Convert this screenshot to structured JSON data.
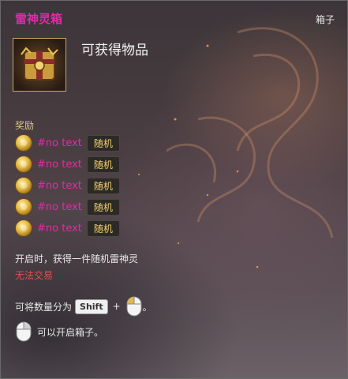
{
  "tooltip": {
    "title": "雷神灵箱",
    "type": "箱子",
    "subtitle": "可获得物品",
    "section_label": "奖励",
    "rewards": [
      {
        "name": "#no text",
        "tag": "随机"
      },
      {
        "name": "#no text",
        "tag": "随机"
      },
      {
        "name": "#no text",
        "tag": "随机"
      },
      {
        "name": "#no text",
        "tag": "随机"
      },
      {
        "name": "#no text",
        "tag": "随机"
      }
    ],
    "description": "开启时，获得一件随机雷神灵",
    "trade_status": "无法交易",
    "split_hint": {
      "prefix": "可将数量分为",
      "key": "Shift",
      "plus": "+",
      "suffix": "。"
    },
    "open_hint": "可以开启箱子。"
  },
  "colors": {
    "title": "#e22aa9",
    "warn": "#e0504b",
    "section": "#d6c48a",
    "tag": "#f3d071"
  },
  "icons": {
    "item": "treasure-box-icon",
    "reward": "coin-icon",
    "mouse": "mouse-icon"
  }
}
